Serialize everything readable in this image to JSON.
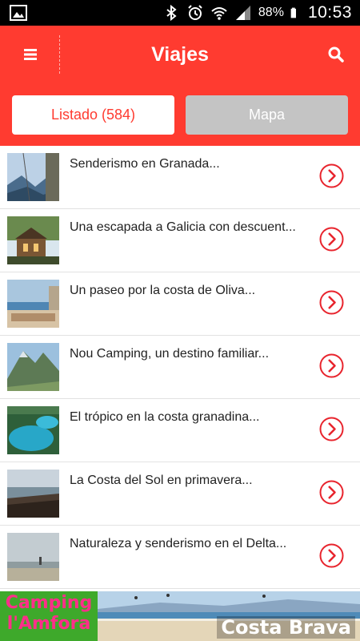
{
  "status_bar": {
    "battery_percent": "88%",
    "time": "10:53",
    "icons": [
      "image-icon",
      "bluetooth-icon",
      "alarm-icon",
      "wifi-icon",
      "signal-icon",
      "battery-icon"
    ]
  },
  "header": {
    "title": "Viajes",
    "menu_icon": "menu-icon",
    "search_icon": "search-icon",
    "color": "#ff3b30"
  },
  "tabs": [
    {
      "label": "Listado (584)",
      "active": true
    },
    {
      "label": "Mapa",
      "active": false
    }
  ],
  "items": [
    {
      "label": "Senderismo en Granada..."
    },
    {
      "label": "Una escapada a Galicia con descuent..."
    },
    {
      "label": "Un paseo por la costa de Oliva..."
    },
    {
      "label": "Nou Camping, un destino familiar..."
    },
    {
      "label": "El trópico en la costa granadina..."
    },
    {
      "label": "La Costa del Sol en primavera..."
    },
    {
      "label": "Naturaleza y senderismo en el Delta..."
    }
  ],
  "banner": {
    "line1": "Camping",
    "line2": "l'Amfora",
    "right_text": "Costa Brava"
  }
}
